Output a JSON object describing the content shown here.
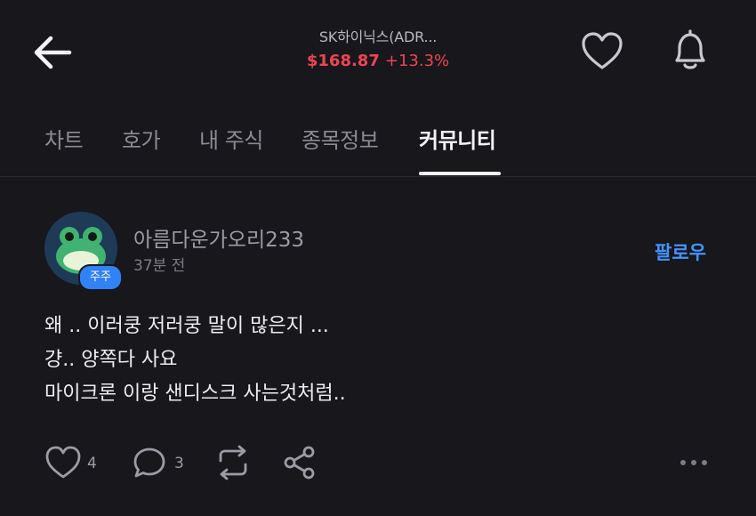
{
  "header": {
    "stock_name": "SK하이닉스(ADR...",
    "price": "$168.87",
    "change": "+13.3%",
    "back_icon": "back-arrow-icon",
    "favorite_icon": "heart-icon",
    "alert_icon": "bell-icon"
  },
  "tabs": [
    {
      "label": "차트"
    },
    {
      "label": "호가"
    },
    {
      "label": "내 주식"
    },
    {
      "label": "종목정보"
    },
    {
      "label": "커뮤니티",
      "active": true
    }
  ],
  "post": {
    "author": "아름다운가오리233",
    "time": "37분 전",
    "badge": "주주",
    "follow_label": "팔로우",
    "lines": [
      "왜 .. 이러쿵 저러쿵 말이 많은지 ...",
      "걍.. 양쪽다 사요",
      "마이크론 이랑 샌디스크 사는것처럼.."
    ],
    "likes": "4",
    "comments": "3"
  },
  "colors": {
    "background": "#17171c",
    "price_red": "#ef4452",
    "accent_blue": "#3182f6",
    "follow_blue": "#4593fc"
  }
}
